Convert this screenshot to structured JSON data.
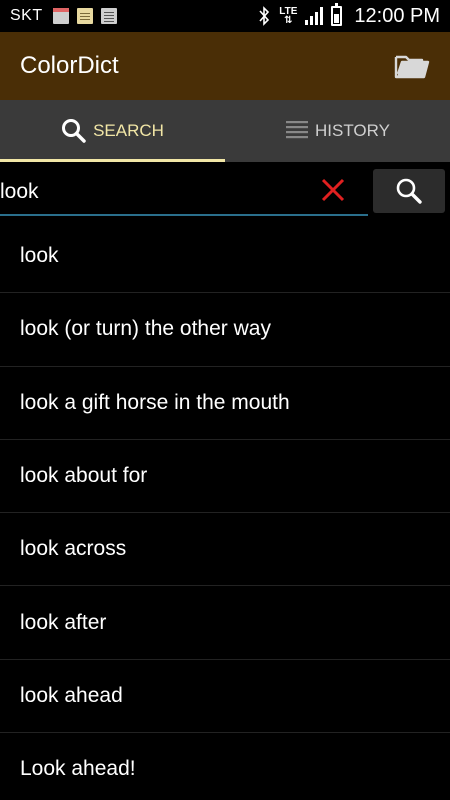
{
  "status_bar": {
    "carrier": "SKT",
    "network": "LTE",
    "time": "12:00 PM"
  },
  "app_bar": {
    "title": "ColorDict",
    "folder_icon": "folder-icon"
  },
  "tabs": [
    {
      "label": "SEARCH",
      "icon": "search-icon",
      "active": true
    },
    {
      "label": "HISTORY",
      "icon": "list-icon",
      "active": false
    }
  ],
  "search": {
    "value": "look"
  },
  "results": [
    {
      "label": "look"
    },
    {
      "label": "look (or turn) the other way"
    },
    {
      "label": "look a gift horse in the mouth"
    },
    {
      "label": "look about for"
    },
    {
      "label": "look across"
    },
    {
      "label": "look after"
    },
    {
      "label": "look ahead"
    },
    {
      "label": "Look ahead!"
    }
  ],
  "colors": {
    "app_bar": "#4a2e06",
    "tab_bar": "#3a3a3a",
    "active_tab": "#f1e6a6",
    "input_underline": "#2a6f8c",
    "clear_icon": "#e02020"
  }
}
